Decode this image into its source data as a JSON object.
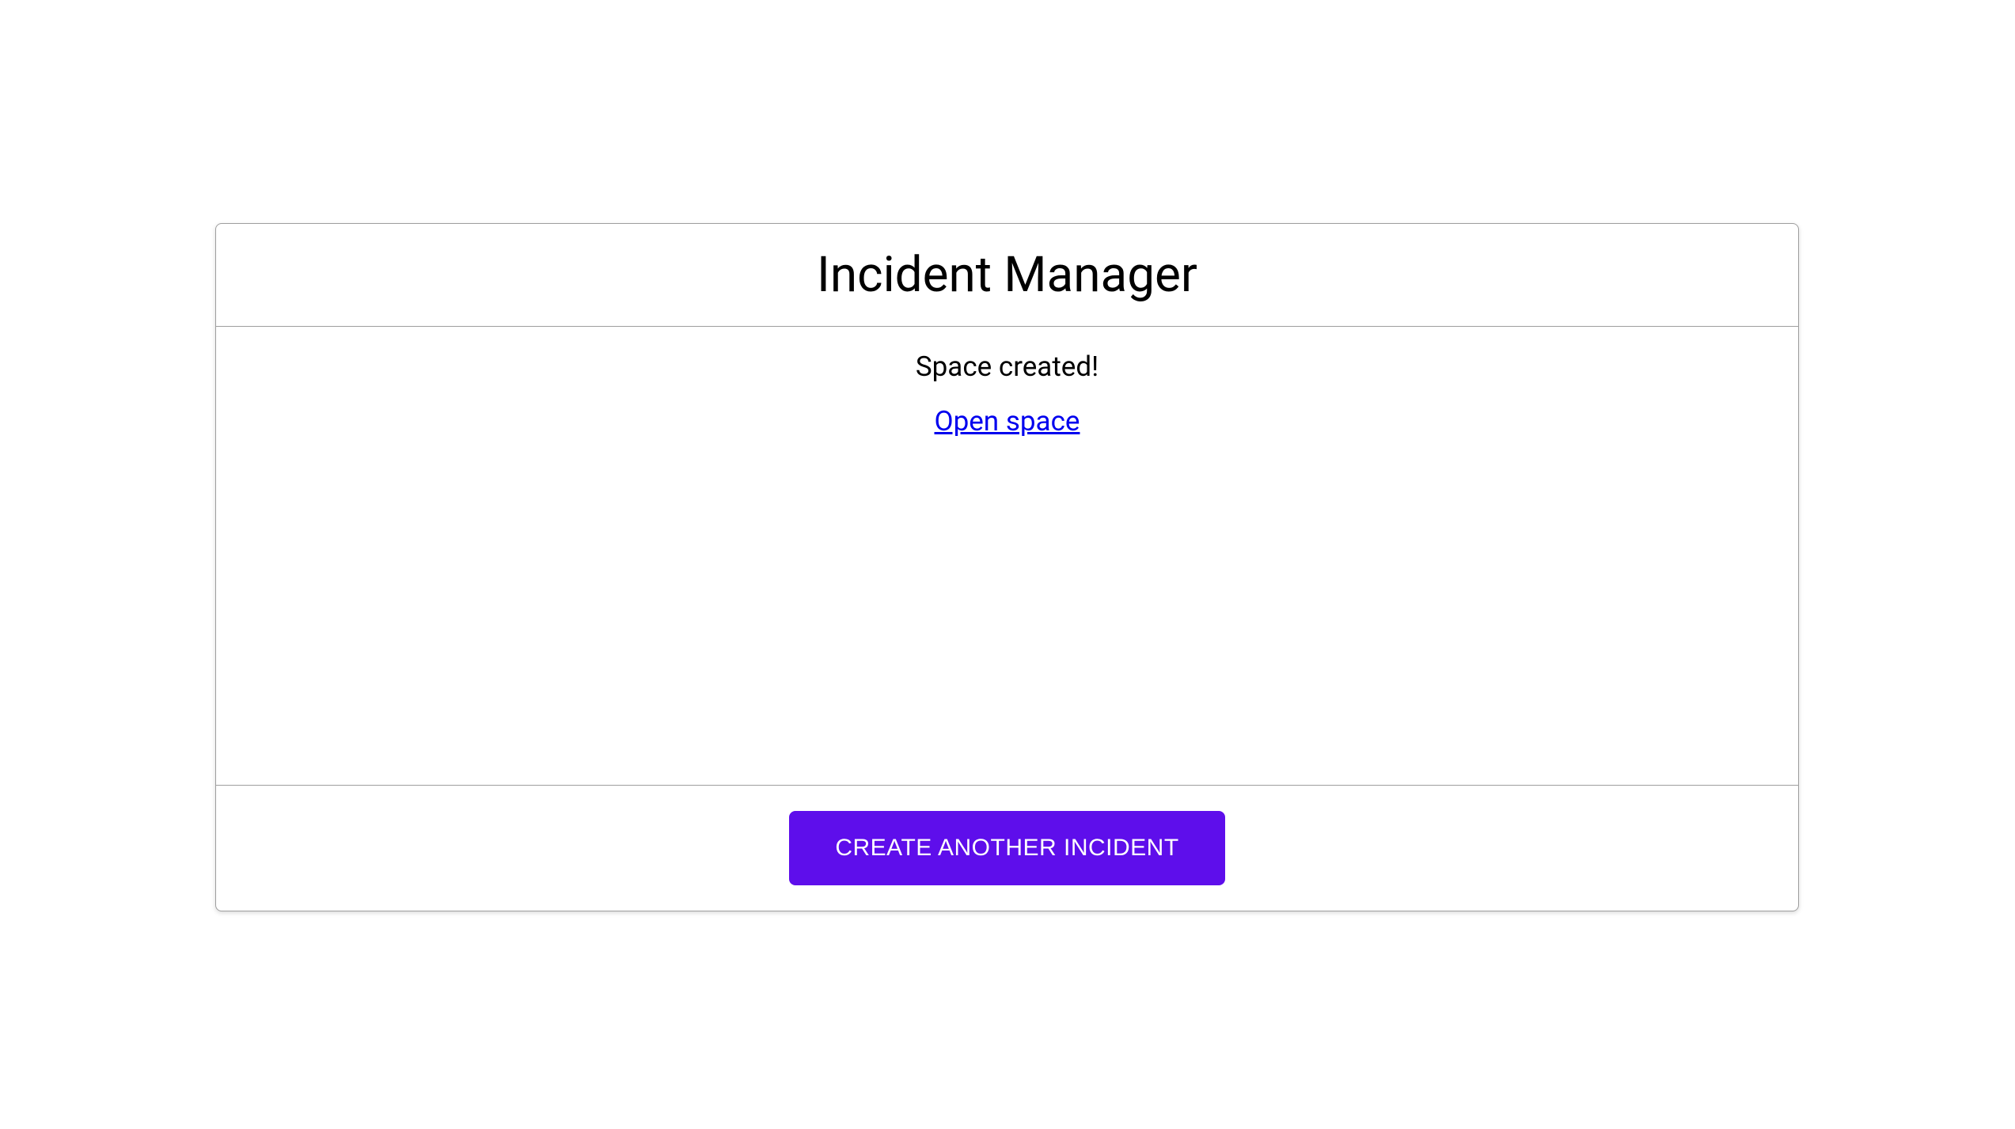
{
  "header": {
    "title": "Incident Manager"
  },
  "body": {
    "status_message": "Space created!",
    "open_space_link_text": "Open space"
  },
  "footer": {
    "create_button_label": "CREATE ANOTHER INCIDENT"
  },
  "colors": {
    "accent": "#5e0eeb",
    "link": "#0000ee",
    "border": "#9e9e9e"
  }
}
